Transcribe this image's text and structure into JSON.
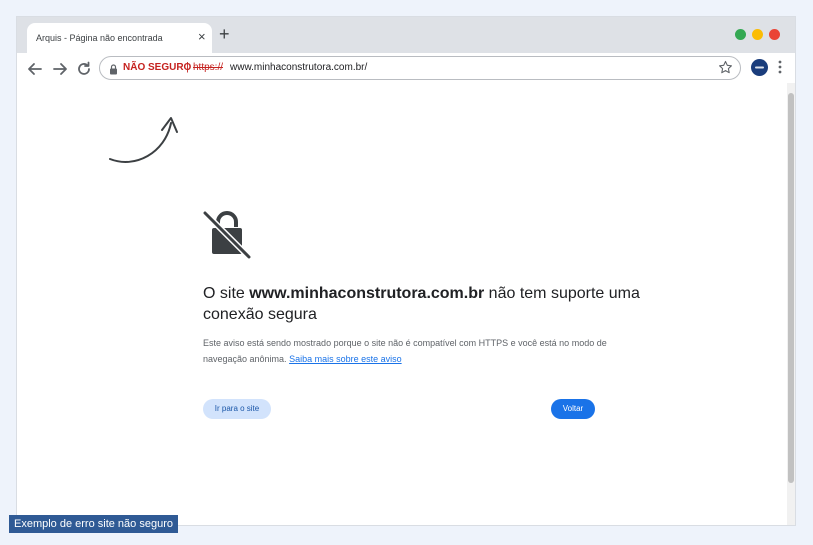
{
  "tab": {
    "title": "Arquis - Página não encontrada",
    "close_icon": "×",
    "new_tab_icon": "+"
  },
  "window_controls": {
    "green": "#34a853",
    "yellow": "#fbbc04",
    "red": "#ea4335"
  },
  "address_bar": {
    "security_label": "NÃO SEGURO",
    "separator": "|",
    "scheme": "https://",
    "url_rest": "www.minhaconstrutora.com.br/",
    "insecure_color": "#c5221f"
  },
  "icons": {
    "back": "arrow-left-icon",
    "forward": "arrow-right-icon",
    "reload": "reload-icon",
    "lock": "lock-icon",
    "star": "star-icon",
    "profile": "profile-avatar-icon",
    "menu": "kebab-menu-icon",
    "broken_lock": "broken-lock-icon"
  },
  "error_page": {
    "heading_prefix": "O site ",
    "heading_domain": "www.minhaconstrutora.com.br",
    "heading_suffix": " não tem suporte uma conexão segura",
    "description": "Este aviso está sendo mostrado porque o site não é compatível com HTTPS e você está no modo de navegação anônima. ",
    "learn_more_link": "Saiba mais sobre este aviso",
    "go_to_site_button": "Ir para o site",
    "back_button": "Voltar",
    "accent_color": "#1a73e8"
  },
  "caption": "Exemplo de erro site não seguro"
}
